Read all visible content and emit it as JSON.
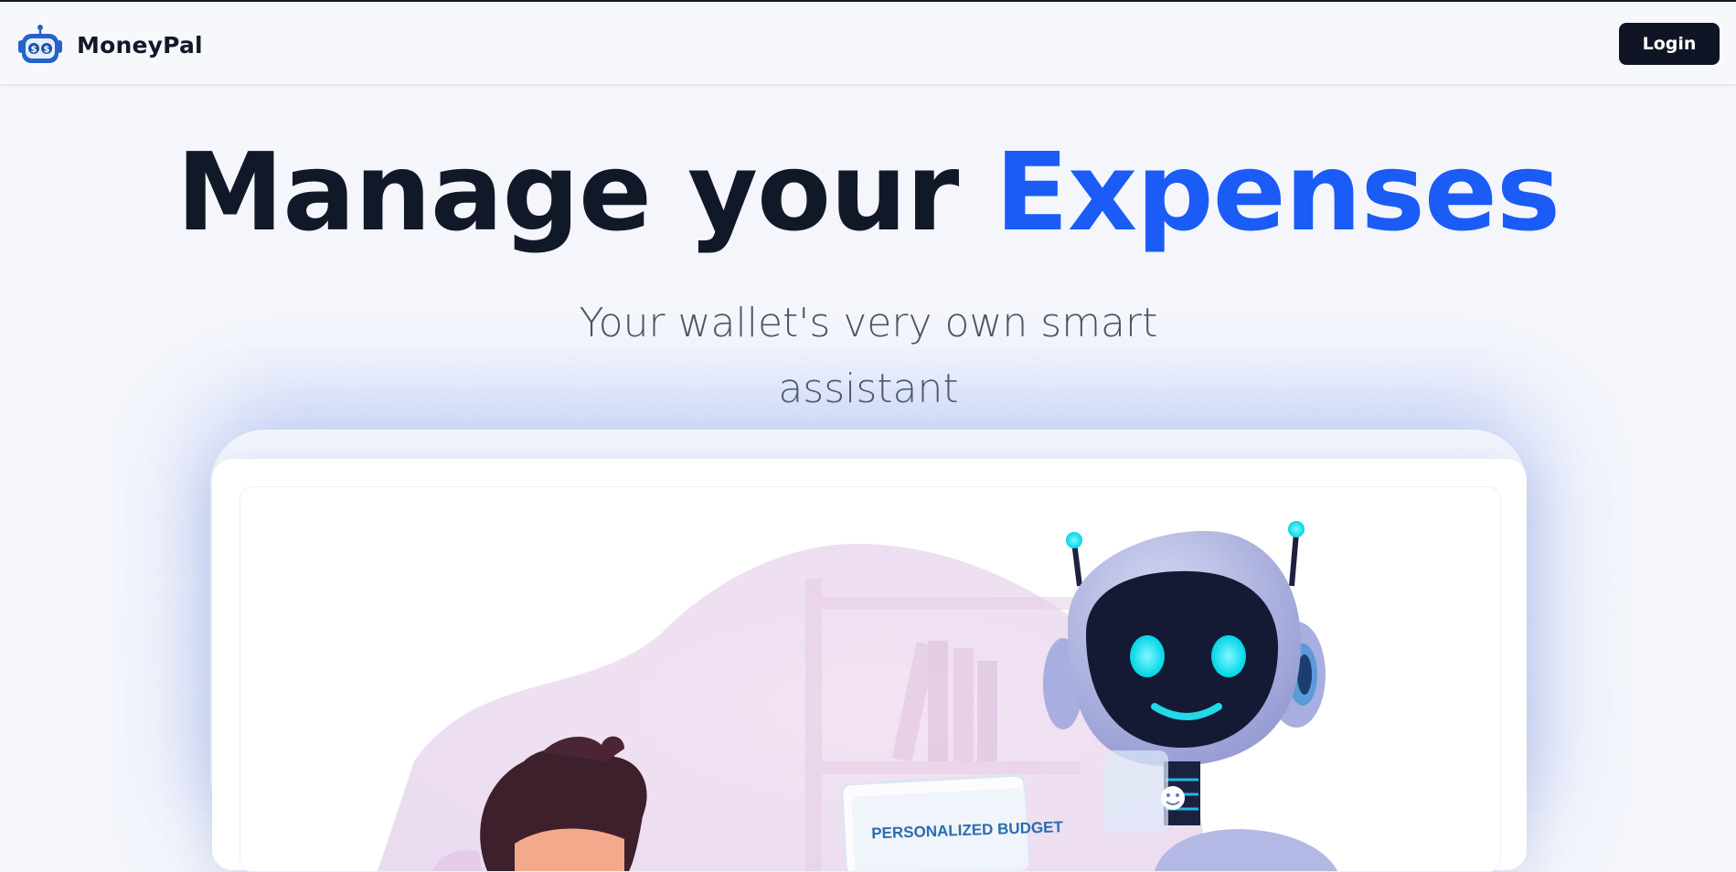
{
  "navbar": {
    "brand_name": "MoneyPal",
    "logo_icon": "robot-wallet-icon",
    "login_label": "Login"
  },
  "hero": {
    "title_main": "Manage your ",
    "title_accent": "Expenses",
    "subtitle": "Your wallet's very own smart assistant",
    "accent_color": "#1a5cf5",
    "title_color": "#111827"
  },
  "illustration": {
    "badge_text": "PERSONALIZED BUDGET"
  }
}
